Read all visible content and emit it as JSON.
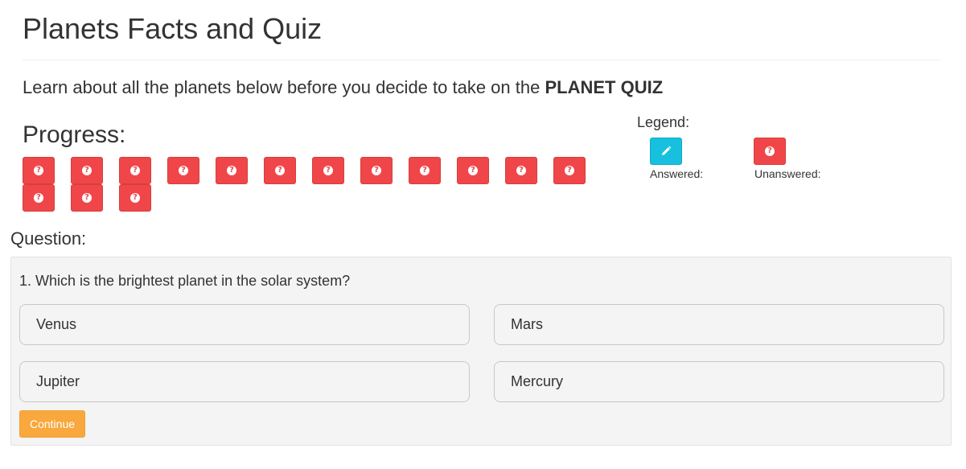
{
  "page": {
    "title": "Planets Facts and Quiz",
    "intro_text": "Learn about all the planets below before you decide to take on the ",
    "intro_bold": "PLANET QUIZ"
  },
  "progress": {
    "heading": "Progress:",
    "total_questions": 15,
    "answered_count": 0,
    "question_icon": "question-circle-icon",
    "unanswered_color": "#f0464a"
  },
  "legend": {
    "title": "Legend:",
    "answered_label": "Answered:",
    "answered_icon": "pencil-icon",
    "answered_color": "#17c0df",
    "unanswered_label": "Unanswered:",
    "unanswered_icon": "question-circle-icon"
  },
  "question": {
    "heading": "Question:",
    "text": "1. Which is the brightest planet in the solar system?",
    "answers": [
      "Venus",
      "Mars",
      "Jupiter",
      "Mercury"
    ],
    "continue_label": "Continue",
    "continue_color": "#f8a83c"
  }
}
